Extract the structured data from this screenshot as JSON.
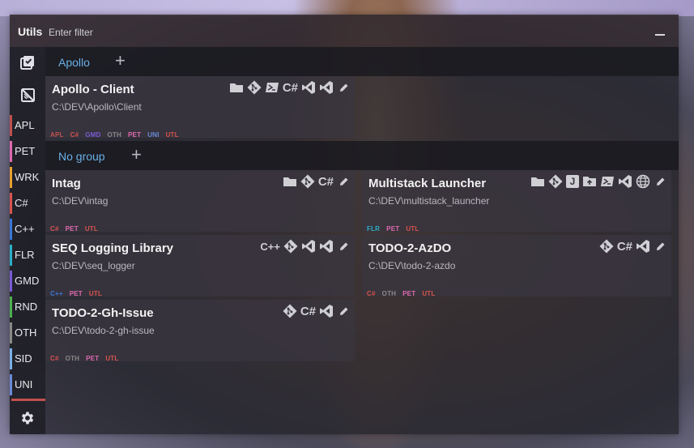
{
  "window": {
    "app_title": "Utils",
    "filter_placeholder": "Enter filter",
    "filter_value": ""
  },
  "sidebar": {
    "items": [
      {
        "label": "APL",
        "color": "#c0504d"
      },
      {
        "label": "PET",
        "color": "#e06ab0"
      },
      {
        "label": "WRK",
        "color": "#e8a030"
      },
      {
        "label": "C#",
        "color": "#d9534f"
      },
      {
        "label": "C++",
        "color": "#3a78d6"
      },
      {
        "label": "FLR",
        "color": "#2ab0c8"
      },
      {
        "label": "GMD",
        "color": "#7a5ad6"
      },
      {
        "label": "RND",
        "color": "#4cb050"
      },
      {
        "label": "OTH",
        "color": "#888888"
      },
      {
        "label": "SID",
        "color": "#7ab0e8"
      },
      {
        "label": "UNI",
        "color": "#6a8ad8"
      }
    ]
  },
  "groups": [
    {
      "name": "Apollo",
      "projects": [
        {
          "title": "Apollo - Client",
          "path": "C:\\DEV\\Apollo\\Client",
          "icons": [
            "folder-icon",
            "git-icon",
            "terminal-icon",
            "csharp-icon",
            "visual-studio-icon",
            "vscode-icon",
            "pencil-icon"
          ],
          "tags": [
            {
              "label": "APL",
              "color": "#c0504d"
            },
            {
              "label": "C#",
              "color": "#d9534f"
            },
            {
              "label": "GMD",
              "color": "#7a5ad6"
            },
            {
              "label": "OTH",
              "color": "#888888"
            },
            {
              "label": "PET",
              "color": "#e06ab0"
            },
            {
              "label": "UNI",
              "color": "#6a8ad8"
            },
            {
              "label": "UTL",
              "color": "#d9534f"
            }
          ]
        }
      ]
    },
    {
      "name": "No group",
      "projects": [
        {
          "title": "Intag",
          "path": "C:\\DEV\\intag",
          "icons": [
            "folder-icon",
            "git-icon",
            "csharp-icon",
            "pencil-icon"
          ],
          "tags": [
            {
              "label": "C#",
              "color": "#d9534f"
            },
            {
              "label": "PET",
              "color": "#e06ab0"
            },
            {
              "label": "UTL",
              "color": "#d9534f"
            }
          ]
        },
        {
          "title": "Multistack Launcher",
          "path": "C:\\DEV\\multistack_launcher",
          "icons": [
            "folder-icon",
            "git-icon",
            "jetbrains-icon",
            "publish-icon",
            "terminal-icon",
            "vscode-icon",
            "globe-icon",
            "pencil-icon"
          ],
          "tags": [
            {
              "label": "FLR",
              "color": "#2ab0c8"
            },
            {
              "label": "PET",
              "color": "#e06ab0"
            },
            {
              "label": "UTL",
              "color": "#d9534f"
            }
          ]
        },
        {
          "title": "SEQ Logging Library",
          "path": "C:\\DEV\\seq_logger",
          "icons": [
            "cpp-icon",
            "git-icon",
            "visual-studio-icon",
            "vscode-icon",
            "pencil-icon"
          ],
          "tags": [
            {
              "label": "C++",
              "color": "#3a78d6"
            },
            {
              "label": "PET",
              "color": "#e06ab0"
            },
            {
              "label": "UTL",
              "color": "#d9534f"
            }
          ]
        },
        {
          "title": "TODO-2-AzDO",
          "path": "C:\\DEV\\todo-2-azdo",
          "icons": [
            "git-icon",
            "csharp-icon",
            "vscode-icon",
            "pencil-icon"
          ],
          "tags": [
            {
              "label": "C#",
              "color": "#d9534f"
            },
            {
              "label": "OTH",
              "color": "#888888"
            },
            {
              "label": "PET",
              "color": "#e06ab0"
            },
            {
              "label": "UTL",
              "color": "#d9534f"
            }
          ]
        },
        {
          "title": "TODO-2-Gh-Issue",
          "path": "C:\\DEV\\todo-2-gh-issue",
          "icons": [
            "git-icon",
            "csharp-icon",
            "vscode-icon",
            "pencil-icon"
          ],
          "tags": [
            {
              "label": "C#",
              "color": "#d9534f"
            },
            {
              "label": "OTH",
              "color": "#888888"
            },
            {
              "label": "PET",
              "color": "#e06ab0"
            },
            {
              "label": "UTL",
              "color": "#d9534f"
            }
          ]
        }
      ]
    }
  ]
}
